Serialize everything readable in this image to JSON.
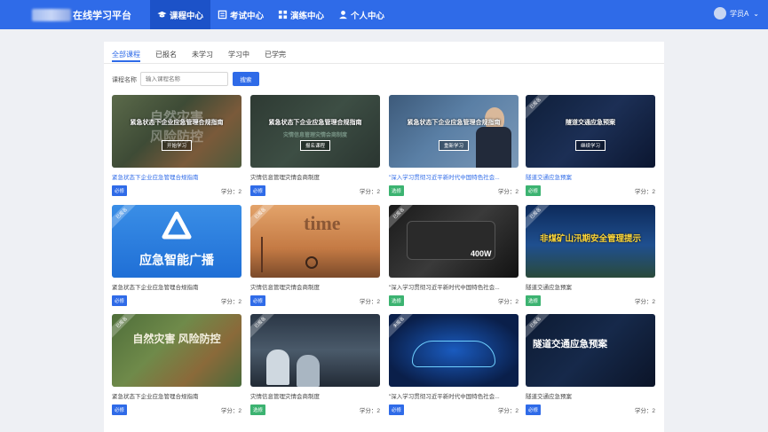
{
  "header": {
    "app_title": "在线学习平台",
    "nav": [
      {
        "label": "课程中心",
        "icon": "graduation-cap-icon",
        "active": true
      },
      {
        "label": "考试中心",
        "icon": "exam-icon",
        "active": false
      },
      {
        "label": "演练中心",
        "icon": "drill-icon",
        "active": false
      },
      {
        "label": "个人中心",
        "icon": "user-icon",
        "active": false
      }
    ],
    "user_name": "学员A"
  },
  "tabs": [
    {
      "label": "全部课程",
      "active": true
    },
    {
      "label": "已报名",
      "active": false
    },
    {
      "label": "未学习",
      "active": false
    },
    {
      "label": "学习中",
      "active": false
    },
    {
      "label": "已学完",
      "active": false
    }
  ],
  "search": {
    "label": "课程名称",
    "placeholder": "输入课程名称",
    "button": "搜索"
  },
  "courses": [
    {
      "title": "紧急状态下企业应急管理合规指南",
      "thumb_title": "紧急状态下企业应急管理合规指南",
      "thumb_button": "开始学习",
      "badge": "必修",
      "credit": "学分：2",
      "title_highlight": true
    },
    {
      "title": "灾情信息管理灾情会商制度",
      "thumb_title": "紧急状态下企业应急管理合规指南",
      "thumb_button": "报名课程",
      "badge": "必修",
      "credit": "学分：2",
      "title_highlight": false
    },
    {
      "title": "\"深入学习贯彻习近平新时代中国特色社会...",
      "thumb_title": "紧急状态下企业应急管理合规指南",
      "thumb_button": "重新学习",
      "badge": "选修",
      "credit": "学分：2",
      "title_highlight": false
    },
    {
      "title": "隧道交通应急预案",
      "thumb_title": "隧道交通应急预案",
      "thumb_button": "继续学习",
      "badge": "必修",
      "credit": "学分：2",
      "title_highlight": false
    },
    {
      "title": "紧急状态下企业应急管理合规指南",
      "thumb_title": "应急智能广播",
      "thumb_button": "",
      "badge": "必修",
      "credit": "学分：2",
      "title_highlight": false
    },
    {
      "title": "灾情信息管理灾情会商制度",
      "thumb_title": "",
      "thumb_button": "",
      "badge": "必修",
      "credit": "学分：2",
      "title_highlight": false
    },
    {
      "title": "\"深入学习贯彻习近平新时代中国特色社会...",
      "thumb_title": "",
      "thumb_button": "",
      "badge": "选修",
      "credit": "学分：2",
      "title_highlight": false
    },
    {
      "title": "隧道交通应急预案",
      "thumb_title": "非煤矿山汛期安全管理提示",
      "thumb_button": "",
      "badge": "选修",
      "credit": "学分：2",
      "title_highlight": false
    },
    {
      "title": "紧急状态下企业应急管理合规指南",
      "thumb_title": "自然灾害 风险防控",
      "thumb_button": "",
      "badge": "必修",
      "credit": "学分：2",
      "title_highlight": false
    },
    {
      "title": "灾情信息管理灾情会商制度",
      "thumb_title": "",
      "thumb_button": "",
      "badge": "选修",
      "credit": "学分：2",
      "title_highlight": false
    },
    {
      "title": "\"深入学习贯彻习近平新时代中国特色社会...",
      "thumb_title": "",
      "thumb_button": "",
      "badge": "必修",
      "credit": "学分：2",
      "title_highlight": false
    },
    {
      "title": "隧道交通应急预案",
      "thumb_title": "隧道交通应急预案",
      "thumb_button": "",
      "badge": "必修",
      "credit": "学分：2",
      "title_highlight": false
    }
  ],
  "colors": {
    "primary": "#2f6be8",
    "required_badge": "#2f6be8",
    "elective_badge": "#3cb371"
  }
}
